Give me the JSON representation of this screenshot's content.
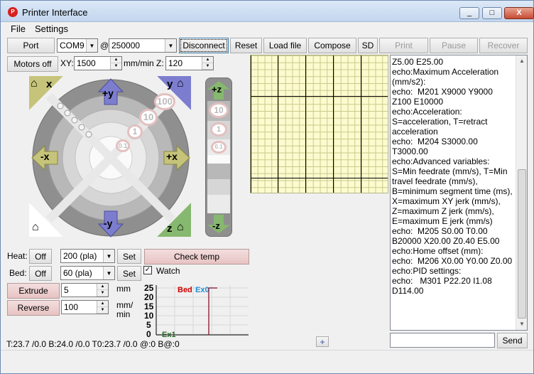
{
  "window": {
    "title": "Printer Interface",
    "min": "_",
    "max": "□",
    "close": "X"
  },
  "menu": [
    "File",
    "Settings"
  ],
  "toolbar": {
    "port": "Port",
    "port_value": "COM9",
    "at": "@",
    "baud_value": "250000",
    "disconnect": "Disconnect",
    "reset": "Reset",
    "load_file": "Load file",
    "compose": "Compose",
    "sd": "SD",
    "print": "Print",
    "pause": "Pause",
    "recover": "Recover"
  },
  "motion": {
    "motors_off": "Motors off",
    "xy_label": "XY:",
    "xy_value": "1500",
    "unit": "mm/min",
    "z_label": "Z:",
    "z_value": "120"
  },
  "jog": {
    "home_x": "x",
    "home_y": "y",
    "home_z": "z",
    "plus_y": "+y",
    "minus_y": "-y",
    "plus_x": "+x",
    "minus_x": "-x",
    "steps": [
      "100",
      "10",
      "1",
      "0.1"
    ],
    "plus_z": "+z",
    "minus_z": "-z",
    "z_steps": [
      "10",
      "1",
      "0.1"
    ]
  },
  "temps": {
    "heat_label": "Heat:",
    "heat_off": "Off",
    "heat_value": "200 (pla)",
    "set": "Set",
    "check_temp": "Check temp",
    "bed_label": "Bed:",
    "bed_off": "Off",
    "bed_value": "60 (pla)",
    "watch": "Watch",
    "watch_checked": "✓"
  },
  "extrude": {
    "extrude": "Extrude",
    "extrude_value": "5",
    "extrude_unit": "mm",
    "reverse": "Reverse",
    "reverse_value": "100",
    "reverse_unit_1": "mm/",
    "reverse_unit_2": "min"
  },
  "graph": {
    "yticks": [
      "25",
      "20",
      "15",
      "10",
      "5",
      "0"
    ],
    "bed_label": "Bed",
    "ex0_label": "Ex0",
    "ex1_label": "Ex1",
    "bed_color": "#cc0000",
    "ex0_color": "#1f8fd8",
    "ex1_color": "#2d6b2d"
  },
  "console_text": "Z5.00 E25.00\necho:Maximum Acceleration (mm/s2):\necho:  M201 X9000 Y9000 Z100 E10000\necho:Acceleration: S=acceleration, T=retract acceleration\necho:  M204 S3000.00 T3000.00\necho:Advanced variables: S=Min feedrate (mm/s), T=Min travel feedrate (mm/s), B=minimum segment time (ms), X=maximum XY jerk (mm/s),  Z=maximum Z jerk (mm/s),  E=maximum E jerk (mm/s)\necho:  M205 S0.00 T0.00 B20000 X20.00 Z0.40 E5.00\necho:Home offset (mm):\necho:  M206 X0.00 Y0.00 Z0.00\necho:PID settings:\necho:   M301 P22.20 I1.08 D114.00",
  "send": "Send",
  "add": "+",
  "status": "T:23.7 /0.0 B:24.0 /0.0 T0:23.7 /0.0 @:0 B@:0"
}
